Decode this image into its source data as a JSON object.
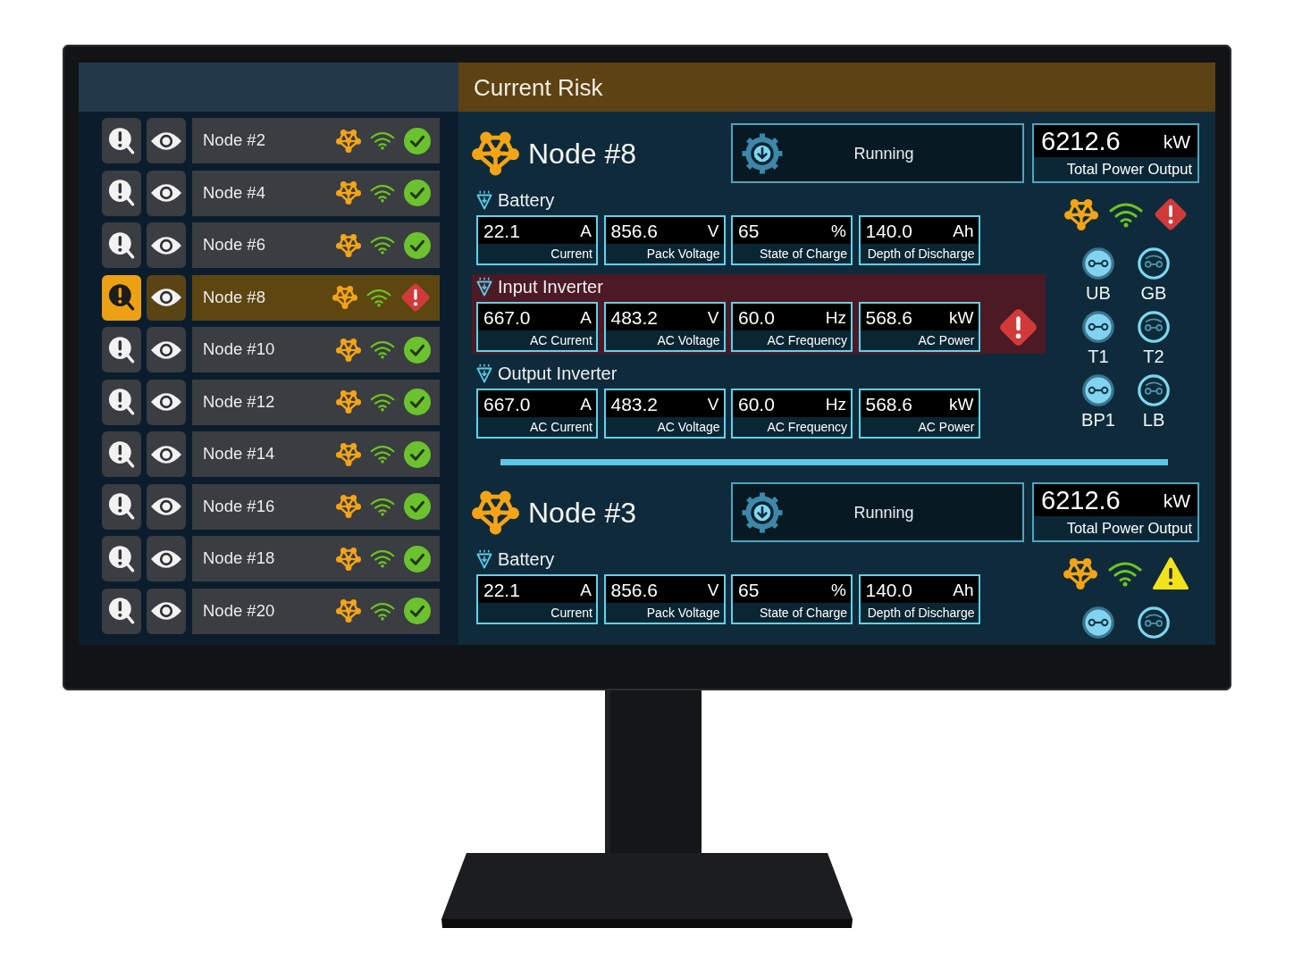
{
  "sidebar": {
    "nodes": [
      {
        "label": "Node #2",
        "selected": false,
        "kind": "ok"
      },
      {
        "label": "Node #4",
        "selected": false,
        "kind": "ok"
      },
      {
        "label": "Node #6",
        "selected": false,
        "kind": "ok"
      },
      {
        "label": "Node #8",
        "selected": true,
        "kind": "alert"
      },
      {
        "label": "Node #10",
        "selected": false,
        "kind": "ok"
      },
      {
        "label": "Node #12",
        "selected": false,
        "kind": "ok"
      },
      {
        "label": "Node #14",
        "selected": false,
        "kind": "ok"
      },
      {
        "label": "Node #16",
        "selected": false,
        "kind": "ok"
      },
      {
        "label": "Node #18",
        "selected": false,
        "kind": "ok"
      },
      {
        "label": "Node #20",
        "selected": false,
        "kind": "ok"
      }
    ]
  },
  "panel": {
    "title": "Current Risk"
  },
  "details": [
    {
      "title": "Node #8",
      "kind": "critical",
      "state": "Running",
      "total_power": {
        "value": "6212.6",
        "unit": "kW",
        "label": "Total Power Output"
      },
      "groups": [
        {
          "title": "Battery",
          "alarm": false,
          "metrics": [
            {
              "value": "22.1",
              "unit": "A",
              "label": "Current"
            },
            {
              "value": "856.6",
              "unit": "V",
              "label": "Pack Voltage"
            },
            {
              "value": "65",
              "unit": "%",
              "label": "State of Charge"
            },
            {
              "value": "140.0",
              "unit": "Ah",
              "label": "Depth of Discharge"
            }
          ]
        },
        {
          "title": "Input Inverter",
          "alarm": true,
          "metrics": [
            {
              "value": "667.0",
              "unit": "A",
              "label": "AC Current"
            },
            {
              "value": "483.2",
              "unit": "V",
              "label": "AC Voltage"
            },
            {
              "value": "60.0",
              "unit": "Hz",
              "label": "AC Frequency"
            },
            {
              "value": "568.6",
              "unit": "kW",
              "label": "AC Power"
            }
          ]
        },
        {
          "title": "Output Inverter",
          "alarm": false,
          "metrics": [
            {
              "value": "667.0",
              "unit": "A",
              "label": "AC Current"
            },
            {
              "value": "483.2",
              "unit": "V",
              "label": "AC Voltage"
            },
            {
              "value": "60.0",
              "unit": "Hz",
              "label": "AC Frequency"
            },
            {
              "value": "568.6",
              "unit": "kW",
              "label": "AC Power"
            }
          ]
        }
      ],
      "breakers": [
        {
          "label": "UB",
          "closed": true
        },
        {
          "label": "GB",
          "closed": false
        },
        {
          "label": "T1",
          "closed": true
        },
        {
          "label": "T2",
          "closed": false
        },
        {
          "label": "BP1",
          "closed": true
        },
        {
          "label": "LB",
          "closed": false
        }
      ]
    },
    {
      "title": "Node #3",
      "kind": "warning",
      "state": "Running",
      "total_power": {
        "value": "6212.6",
        "unit": "kW",
        "label": "Total Power Output"
      },
      "groups": [
        {
          "title": "Battery",
          "alarm": false,
          "metrics": [
            {
              "value": "22.1",
              "unit": "A",
              "label": "Current"
            },
            {
              "value": "856.6",
              "unit": "V",
              "label": "Pack Voltage"
            },
            {
              "value": "65",
              "unit": "%",
              "label": "State of Charge"
            },
            {
              "value": "140.0",
              "unit": "Ah",
              "label": "Depth of Discharge"
            }
          ]
        }
      ],
      "breakers": [
        {
          "closed": true
        },
        {
          "closed": false
        }
      ]
    }
  ]
}
